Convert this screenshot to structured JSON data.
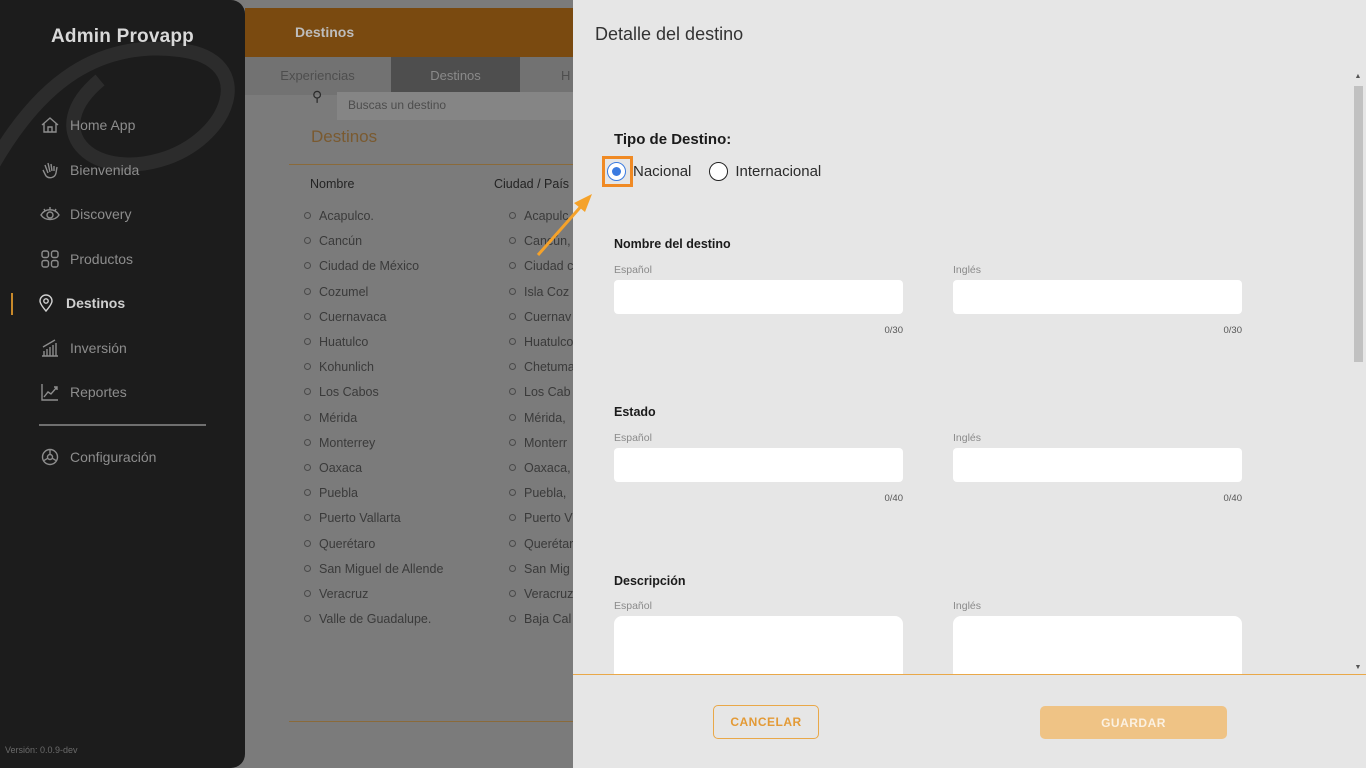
{
  "sidebar": {
    "app_title": "Admin Provapp",
    "items": [
      {
        "label": "Home App",
        "icon": "home-icon"
      },
      {
        "label": "Bienvenida",
        "icon": "wave-hand-icon"
      },
      {
        "label": "Discovery",
        "icon": "eye-icon"
      },
      {
        "label": "Productos",
        "icon": "grid-icon"
      },
      {
        "label": "Destinos",
        "icon": "location-pin-icon",
        "active": true
      },
      {
        "label": "Inversión",
        "icon": "bar-chart-icon"
      },
      {
        "label": "Reportes",
        "icon": "line-chart-icon"
      }
    ],
    "settings_label": "Configuración",
    "version": "Versión: 0.0.9-dev"
  },
  "background": {
    "header_title": "Destinos",
    "tabs": [
      "Experiencias",
      "Destinos",
      "H"
    ],
    "active_tab": "Destinos",
    "search_placeholder": "Buscas un destino",
    "section_title": "Destinos",
    "columns": [
      "Nombre",
      "Ciudad / País"
    ],
    "rows": [
      [
        "Acapulco.",
        "Acapulc"
      ],
      [
        "Cancún",
        "Cancún,"
      ],
      [
        "Ciudad de México",
        "Ciudad c"
      ],
      [
        "Cozumel",
        "Isla Coz"
      ],
      [
        "Cuernavaca",
        "Cuernav"
      ],
      [
        "Huatulco",
        "Huatulco"
      ],
      [
        "Kohunlich",
        "Chetuma"
      ],
      [
        "Los Cabos",
        "Los Cab"
      ],
      [
        "Mérida",
        "Mérida, "
      ],
      [
        "Monterrey",
        "Monterr"
      ],
      [
        "Oaxaca",
        "Oaxaca,"
      ],
      [
        "Puebla",
        "Puebla, "
      ],
      [
        "Puerto Vallarta",
        "Puerto V"
      ],
      [
        "Querétaro",
        "Querétar"
      ],
      [
        "San Miguel de Allende",
        "San Mig"
      ],
      [
        "Veracruz",
        "Veracruz"
      ],
      [
        "Valle de Guadalupe.",
        "Baja Cal"
      ]
    ]
  },
  "drawer": {
    "title": "Detalle del destino",
    "tipo_label": "Tipo de Destino:",
    "radio_options": [
      "Nacional",
      "Internacional"
    ],
    "selected_option": "Nacional",
    "sections": [
      {
        "title": "Nombre del destino",
        "es_label": "Español",
        "en_label": "Inglés",
        "es_counter": "0/30",
        "en_counter": "0/30"
      },
      {
        "title": "Estado",
        "es_label": "Español",
        "en_label": "Inglés",
        "es_counter": "0/40",
        "en_counter": "0/40"
      },
      {
        "title": "Descripción",
        "es_label": "Español",
        "en_label": "Inglés"
      }
    ],
    "cancel_label": "CANCELAR",
    "save_label": "GUARDAR"
  },
  "colors": {
    "accent": "#e9a849",
    "highlight": "#f08a24",
    "radio_selected": "#3b7be0",
    "sidebar_bg": "#1c1c1c",
    "drawer_bg": "#e6e6e6"
  }
}
